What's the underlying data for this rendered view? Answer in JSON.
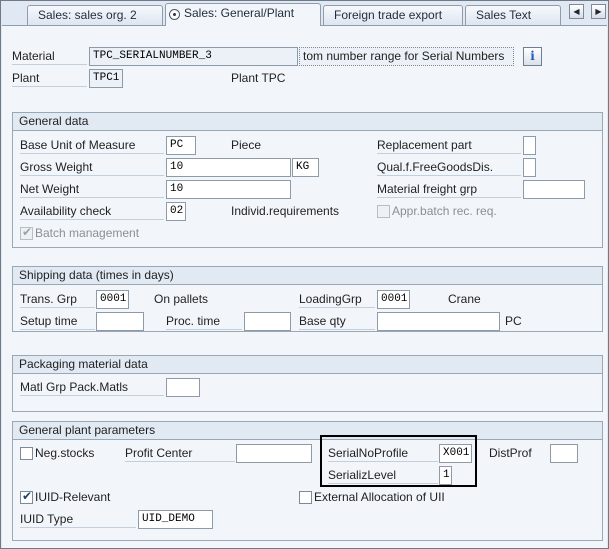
{
  "tabs": [
    {
      "label": "Sales: sales org. 2",
      "active": false
    },
    {
      "label": "Sales: General/Plant",
      "active": true
    },
    {
      "label": "Foreign trade export",
      "active": false
    },
    {
      "label": "Sales Text",
      "active": false
    }
  ],
  "nav": {
    "left": "◀",
    "right": "▶",
    "menu": "▦"
  },
  "header": {
    "material_label": "Material",
    "material_value": "TPC_SERIALNUMBER_3",
    "material_desc": "tom number range for Serial Numbers",
    "info_icon": "i",
    "plant_label": "Plant",
    "plant_value": "TPC1",
    "plant_desc": "Plant TPC"
  },
  "general_data": {
    "title": "General data",
    "base_uom_label": "Base Unit of Measure",
    "base_uom_value": "PC",
    "base_uom_desc": "Piece",
    "replacement_part_label": "Replacement part",
    "replacement_part_value": "",
    "gross_weight_label": "Gross Weight",
    "gross_weight_value": "10",
    "weight_unit": "KG",
    "qual_free_goods_label": "Qual.f.FreeGoodsDis.",
    "qual_free_goods_value": "",
    "net_weight_label": "Net Weight",
    "net_weight_value": "10",
    "freight_grp_label": "Material freight grp",
    "freight_grp_value": "",
    "availability_label": "Availability check",
    "availability_value": "02",
    "availability_desc": "Individ.requirements",
    "appr_batch_label": "Appr.batch rec. req.",
    "appr_batch_checked": false,
    "batch_mgmt_label": "Batch management",
    "batch_mgmt_checked": true
  },
  "shipping": {
    "title": "Shipping data (times in days)",
    "trans_grp_label": "Trans. Grp",
    "trans_grp_value": "0001",
    "trans_grp_desc": "On pallets",
    "loading_grp_label": "LoadingGrp",
    "loading_grp_value": "0001",
    "loading_grp_desc": "Crane",
    "setup_time_label": "Setup time",
    "setup_time_value": "",
    "proc_time_label": "Proc. time",
    "proc_time_value": "",
    "base_qty_label": "Base qty",
    "base_qty_value": "",
    "base_qty_unit": "PC"
  },
  "packaging": {
    "title": "Packaging material data",
    "matl_grp_label": "Matl Grp Pack.Matls",
    "matl_grp_value": ""
  },
  "plant_params": {
    "title": "General plant parameters",
    "neg_stocks_label": "Neg.stocks",
    "neg_stocks_checked": false,
    "profit_center_label": "Profit Center",
    "profit_center_value": "",
    "serial_profile_label": "SerialNoProfile",
    "serial_profile_value": "X001",
    "serial_level_label": "SerializLevel",
    "serial_level_value": "1",
    "dist_prof_label": "DistProf",
    "dist_prof_value": "",
    "iuid_relevant_label": "IUID-Relevant",
    "iuid_relevant_checked": true,
    "ext_alloc_label": "External Allocation of UII",
    "ext_alloc_checked": false,
    "iuid_type_label": "IUID Type",
    "iuid_type_value": "UID_DEMO"
  },
  "checkmark": "✔",
  "colors": {
    "background": "#dfe8f3",
    "page": "#f2f6fb",
    "group_header": "#e1e9f3",
    "border": "#9aa7b5",
    "info_icon": "#1a5fb4"
  }
}
